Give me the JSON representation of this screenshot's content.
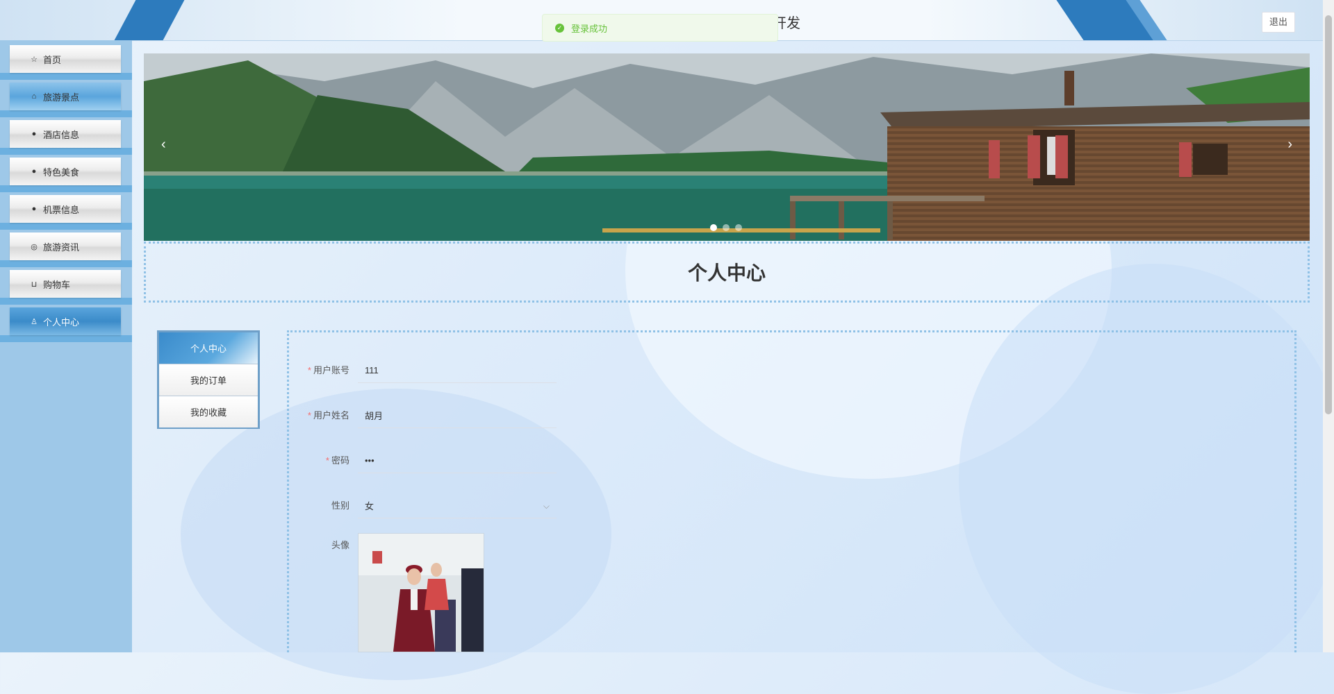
{
  "header": {
    "site_title": "开发",
    "logout_label": "退出"
  },
  "toast": {
    "message": "登录成功"
  },
  "sidebar": {
    "items": [
      {
        "label": "首页",
        "icon": "star-icon"
      },
      {
        "label": "旅游景点",
        "icon": "bag-icon"
      },
      {
        "label": "酒店信息",
        "icon": "info-icon"
      },
      {
        "label": "特色美食",
        "icon": "question-icon"
      },
      {
        "label": "机票信息",
        "icon": "info-icon"
      },
      {
        "label": "旅游资讯",
        "icon": "globe-icon"
      },
      {
        "label": "购物车",
        "icon": "cart-icon"
      },
      {
        "label": "个人中心",
        "icon": "user-icon"
      }
    ],
    "active_index": 7
  },
  "banner": {
    "slide_count": 3,
    "active_slide": 0
  },
  "page": {
    "title": "个人中心"
  },
  "tabs": [
    {
      "label": "个人中心"
    },
    {
      "label": "我的订单"
    },
    {
      "label": "我的收藏"
    }
  ],
  "form": {
    "account": {
      "label": "用户账号",
      "value": "111"
    },
    "name": {
      "label": "用户姓名",
      "value": "胡月"
    },
    "password": {
      "label": "密码",
      "value": "•••"
    },
    "gender": {
      "label": "性别",
      "value": "女"
    },
    "avatar": {
      "label": "头像"
    }
  },
  "colors": {
    "accent": "#2d7bbd",
    "sidebar_bg": "#9ec8e8",
    "success": "#67c23a",
    "required": "#f56c6c"
  }
}
